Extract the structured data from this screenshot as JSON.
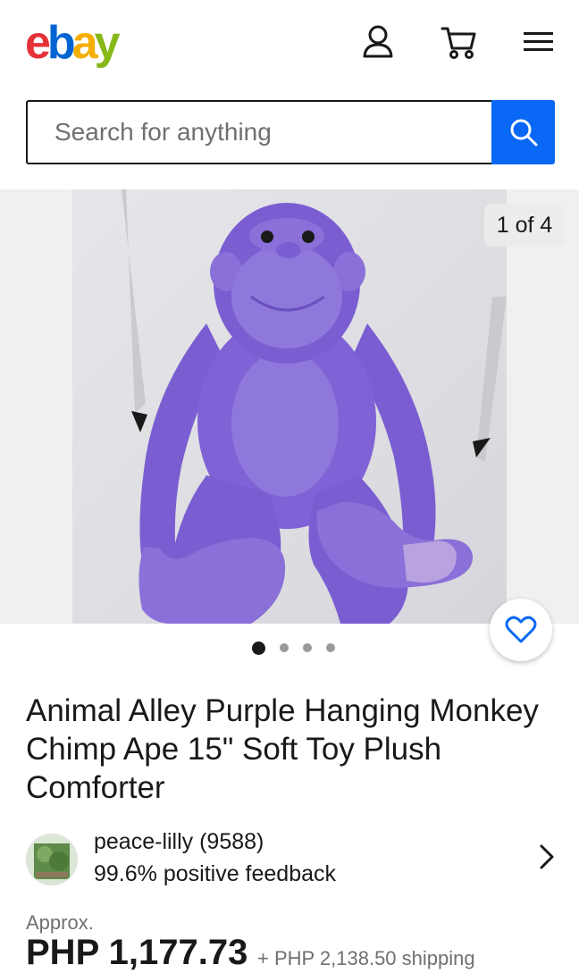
{
  "header": {
    "logo_letters": [
      {
        "char": "e",
        "color": "#e53238"
      },
      {
        "char": "b",
        "color": "#0064d2"
      },
      {
        "char": "a",
        "color": "#f5af02"
      },
      {
        "char": "y",
        "color": "#86b817"
      }
    ],
    "icons": [
      "account-icon",
      "cart-icon",
      "menu-icon"
    ]
  },
  "search": {
    "placeholder": "Search for anything",
    "button_icon": "search-icon",
    "button_color": "#0968f6"
  },
  "gallery": {
    "counter": "1 of 4",
    "dots": {
      "count": 4,
      "active": 1
    },
    "watch_icon": "heart-icon"
  },
  "listing": {
    "title": "Animal Alley Purple Hanging Monkey Chimp Ape 15\" Soft Toy Plush Comforter"
  },
  "seller": {
    "name": "peace-lilly (9588)",
    "feedback": "99.6% positive feedback"
  },
  "price": {
    "approx_label": "Approx.",
    "amount": "PHP 1,177.73",
    "shipping": "+ PHP 2,138.50 shipping"
  }
}
